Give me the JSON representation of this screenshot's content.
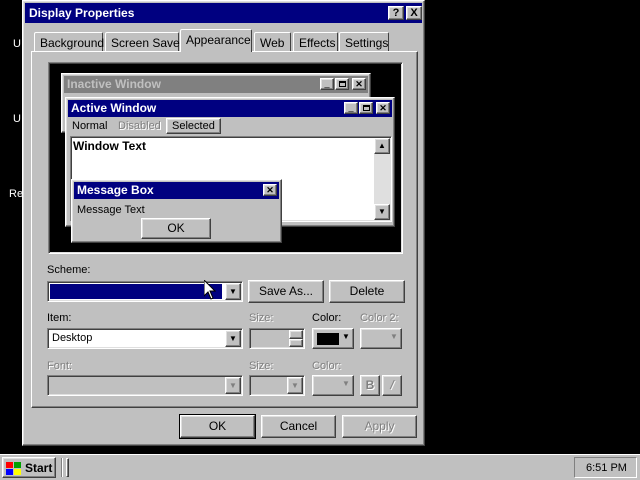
{
  "desktop": {
    "icon_labels": [
      "U",
      "U",
      "Re"
    ]
  },
  "dialog": {
    "title": "Display Properties",
    "help_btn": "?",
    "close_btn": "X",
    "tabs": [
      "Background",
      "Screen Saver",
      "Appearance",
      "Web",
      "Effects",
      "Settings"
    ],
    "selected_tab": "Appearance"
  },
  "preview": {
    "inactive_title": "Inactive Window",
    "active_title": "Active Window",
    "menu_normal": "Normal",
    "menu_disabled": "Disabled",
    "menu_selected": "Selected",
    "window_text": "Window Text",
    "msgbox_title": "Message Box",
    "msgbox_text": "Message Text",
    "msgbox_ok": "OK"
  },
  "appearance": {
    "scheme_label": "Scheme:",
    "scheme_value": "",
    "save_as_label": "Save As...",
    "delete_label": "Delete",
    "item_label": "Item:",
    "item_value": "Desktop",
    "size_label": "Size:",
    "color_label": "Color:",
    "color2_label": "Color 2:",
    "color_value": "#000000",
    "font_label": "Font:",
    "font_size_label": "Size:",
    "font_color_label": "Color:",
    "bold_label": "B",
    "italic_label": "/"
  },
  "footer": {
    "ok_label": "OK",
    "cancel_label": "Cancel",
    "apply_label": "Apply"
  },
  "taskbar": {
    "start_label": "Start",
    "clock": "6:51 PM"
  },
  "colors": {
    "active_title": "#000080",
    "inactive_title": "#808080",
    "desktop": "#000000",
    "face": "#c0c0c0"
  }
}
